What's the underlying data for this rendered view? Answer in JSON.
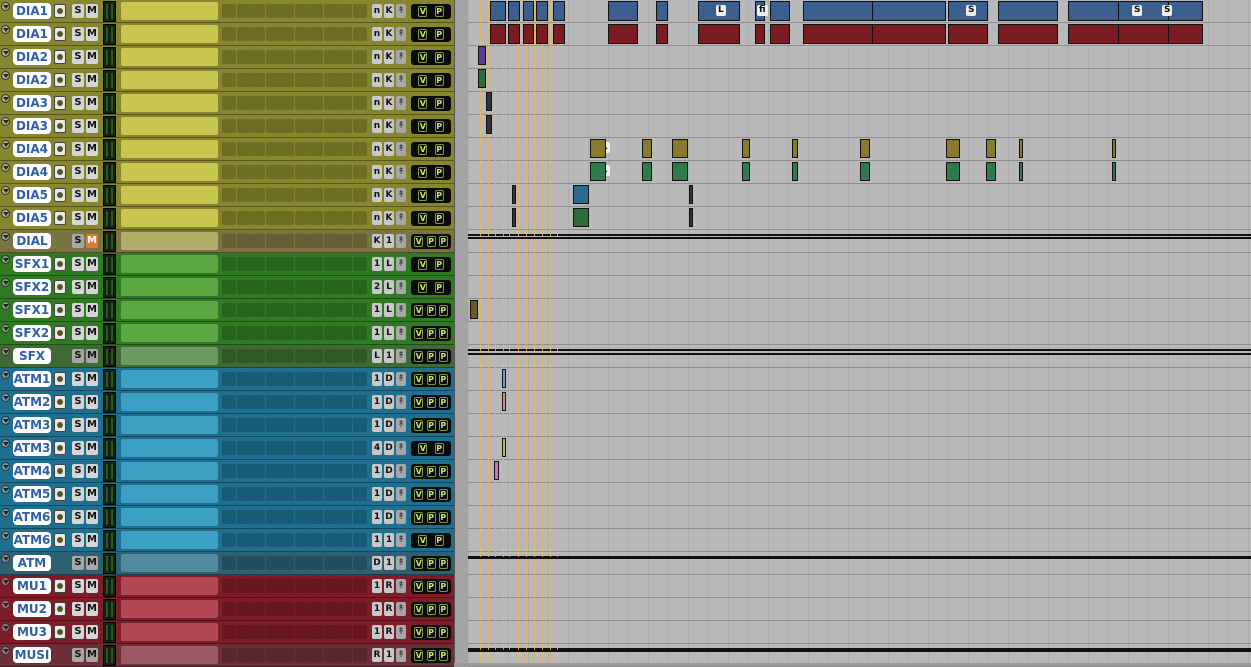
{
  "session": {
    "tracks": [
      {
        "name": "DIA1",
        "s": "S",
        "m": "M",
        "label1": "n",
        "label2": "K",
        "pin": "↟",
        "vp": [
          "V",
          "P"
        ],
        "color": "#c9c650",
        "dark": "#87852d"
      },
      {
        "name": "DIA1",
        "s": "S",
        "m": "M",
        "label1": "n",
        "label2": "K",
        "pin": "↟",
        "vp": [
          "V",
          "P"
        ],
        "color": "#c9c650",
        "dark": "#87852d"
      },
      {
        "name": "DIA2",
        "s": "S",
        "m": "M",
        "label1": "n",
        "label2": "K",
        "pin": "↟",
        "vp": [
          "V",
          "P"
        ],
        "color": "#c9c650",
        "dark": "#87852d"
      },
      {
        "name": "DIA2",
        "s": "S",
        "m": "M",
        "label1": "n",
        "label2": "K",
        "pin": "↟",
        "vp": [
          "V",
          "P"
        ],
        "color": "#c9c650",
        "dark": "#87852d"
      },
      {
        "name": "DIA3",
        "s": "S",
        "m": "M",
        "label1": "n",
        "label2": "K",
        "pin": "↟",
        "vp": [
          "V",
          "P"
        ],
        "color": "#c9c650",
        "dark": "#87852d"
      },
      {
        "name": "DIA3",
        "s": "S",
        "m": "M",
        "label1": "n",
        "label2": "K",
        "pin": "↟",
        "vp": [
          "V",
          "P"
        ],
        "color": "#c9c650",
        "dark": "#87852d"
      },
      {
        "name": "DIA4",
        "s": "S",
        "m": "M",
        "label1": "n",
        "label2": "K",
        "pin": "↟",
        "vp": [
          "V",
          "P"
        ],
        "color": "#c9c650",
        "dark": "#87852d"
      },
      {
        "name": "DIA4",
        "s": "S",
        "m": "M",
        "label1": "n",
        "label2": "K",
        "pin": "↟",
        "vp": [
          "V",
          "P"
        ],
        "color": "#c9c650",
        "dark": "#87852d"
      },
      {
        "name": "DIA5",
        "s": "S",
        "m": "M",
        "label1": "n",
        "label2": "K",
        "pin": "↟",
        "vp": [
          "V",
          "P"
        ],
        "color": "#c9c650",
        "dark": "#87852d"
      },
      {
        "name": "DIA5",
        "s": "S",
        "m": "M",
        "label1": "n",
        "label2": "K",
        "pin": "↟",
        "vp": [
          "V",
          "P"
        ],
        "color": "#c9c650",
        "dark": "#87852d"
      },
      {
        "name": "DIAL",
        "s": "S",
        "m": "M",
        "mute_on": true,
        "aux": true,
        "label1": "K",
        "label2": "1",
        "pin": "↟",
        "vp": [
          "V",
          "P",
          "P"
        ],
        "color": "#b3ac68",
        "dark": "#7a7440"
      },
      {
        "name": "SFX1",
        "s": "S",
        "m": "M",
        "label1": "1",
        "label2": "L",
        "pin": "↟",
        "vp": [
          "V",
          "P"
        ],
        "color": "#5aa841",
        "dark": "#2f7a22"
      },
      {
        "name": "SFX2",
        "s": "S",
        "m": "M",
        "label1": "2",
        "label2": "L",
        "pin": "↟",
        "vp": [
          "V",
          "P"
        ],
        "color": "#5aa841",
        "dark": "#2f7a22"
      },
      {
        "name": "SFX1",
        "s": "S",
        "m": "M",
        "label1": "1",
        "label2": "L",
        "pin": "↟",
        "vp": [
          "V",
          "P",
          "P"
        ],
        "color": "#5aa841",
        "dark": "#2f7a22"
      },
      {
        "name": "SFX2",
        "s": "S",
        "m": "M",
        "label1": "1",
        "label2": "L",
        "pin": "↟",
        "vp": [
          "V",
          "P",
          "P"
        ],
        "color": "#5aa841",
        "dark": "#2f7a22"
      },
      {
        "name": "SFX",
        "s": "S",
        "m": "M",
        "aux": true,
        "label1": "L",
        "label2": "1",
        "pin": "↟",
        "vp": [
          "V",
          "P",
          "P"
        ],
        "color": "#6c9a5e",
        "dark": "#3f6a33"
      },
      {
        "name": "ATM1",
        "s": "S",
        "m": "M",
        "label1": "1",
        "label2": "D",
        "pin": "↟",
        "vp": [
          "V",
          "P",
          "P"
        ],
        "color": "#3c9fc4",
        "dark": "#1e6f90"
      },
      {
        "name": "ATM2",
        "s": "S",
        "m": "M",
        "label1": "1",
        "label2": "D",
        "pin": "↟",
        "vp": [
          "V",
          "P",
          "P"
        ],
        "color": "#3c9fc4",
        "dark": "#1e6f90"
      },
      {
        "name": "ATM3",
        "s": "S",
        "m": "M",
        "label1": "1",
        "label2": "D",
        "pin": "↟",
        "vp": [
          "V",
          "P",
          "P"
        ],
        "color": "#3c9fc4",
        "dark": "#1e6f90"
      },
      {
        "name": "ATM3",
        "s": "S",
        "m": "M",
        "label1": "4",
        "label2": "D",
        "pin": "↟",
        "vp": [
          "V",
          "P"
        ],
        "color": "#3c9fc4",
        "dark": "#1e6f90"
      },
      {
        "name": "ATM4",
        "s": "S",
        "m": "M",
        "label1": "1",
        "label2": "D",
        "pin": "↟",
        "vp": [
          "V",
          "P",
          "P"
        ],
        "color": "#3c9fc4",
        "dark": "#1e6f90"
      },
      {
        "name": "ATM5",
        "s": "S",
        "m": "M",
        "label1": "1",
        "label2": "D",
        "pin": "↟",
        "vp": [
          "V",
          "P",
          "P"
        ],
        "color": "#3c9fc4",
        "dark": "#1e6f90"
      },
      {
        "name": "ATM6",
        "s": "S",
        "m": "M",
        "label1": "1",
        "label2": "D",
        "pin": "↟",
        "vp": [
          "V",
          "P",
          "P"
        ],
        "color": "#3c9fc4",
        "dark": "#1e6f90"
      },
      {
        "name": "ATM6",
        "s": "S",
        "m": "M",
        "label1": "1",
        "label2": "1",
        "pin": "↟",
        "vp": [
          "V",
          "P"
        ],
        "color": "#3c9fc4",
        "dark": "#1e6f90"
      },
      {
        "name": "ATM",
        "s": "S",
        "m": "M",
        "aux": true,
        "label1": "D",
        "label2": "1",
        "pin": "↟",
        "vp": [
          "V",
          "P",
          "P"
        ],
        "color": "#4f8aa0",
        "dark": "#2d6073"
      },
      {
        "name": "MU1",
        "s": "S",
        "m": "M",
        "label1": "1",
        "label2": "R",
        "pin": "↟",
        "vp": [
          "V",
          "P",
          "P"
        ],
        "color": "#b34852",
        "dark": "#7e1d28"
      },
      {
        "name": "MU2",
        "s": "S",
        "m": "M",
        "label1": "1",
        "label2": "R",
        "pin": "↟",
        "vp": [
          "V",
          "P",
          "P"
        ],
        "color": "#b34852",
        "dark": "#7e1d28"
      },
      {
        "name": "MU3",
        "s": "S",
        "m": "M",
        "label1": "1",
        "label2": "R",
        "pin": "↟",
        "vp": [
          "V",
          "P",
          "P"
        ],
        "color": "#b34852",
        "dark": "#7e1d28"
      },
      {
        "name": "MUSI",
        "s": "S",
        "m": "M",
        "aux": true,
        "label1": "R",
        "label2": "1",
        "pin": "↟",
        "vp": [
          "V",
          "P",
          "P"
        ],
        "color": "#9c5a62",
        "dark": "#6d2f37"
      }
    ],
    "clip_labels": [
      "L",
      "fi",
      "S",
      "S",
      "S",
      "S1",
      "M",
      "S1",
      "M"
    ]
  }
}
